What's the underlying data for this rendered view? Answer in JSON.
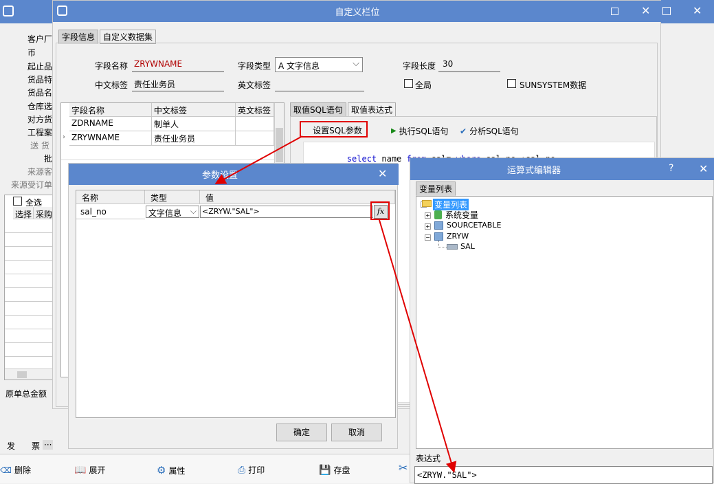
{
  "bg": {
    "left_labels": [
      "客户厂",
      "币",
      "起止品",
      "货品特",
      "货品名",
      "仓库选",
      "对方货",
      "工程案",
      "送  货",
      "批",
      "来源客",
      "来源受订单"
    ],
    "select_all": "全选",
    "grid_headers": [
      "选择",
      "采购"
    ],
    "total_label": "原单总金额",
    "bottom_tabs": [
      "发",
      "票",
      "···"
    ],
    "toolbar": [
      "删除",
      "展开",
      "属性",
      "打印",
      "存盘"
    ]
  },
  "custom_col": {
    "title": "自定义栏位",
    "tabs": [
      "字段信息",
      "自定义数据集"
    ],
    "field_name_label": "字段名称",
    "field_name_value": "ZRYWNAME",
    "field_type_label": "字段类型",
    "field_type_value": "A 文字信息",
    "field_len_label": "字段长度",
    "field_len_value": "30",
    "cn_label": "中文标签",
    "cn_value": "责任业务员",
    "en_label": "英文标签",
    "en_value": "",
    "global_label": "全局",
    "sunsystem_label": "SUNSYSTEM数据",
    "grid_headers": [
      "字段名称",
      "中文标签",
      "英文标签"
    ],
    "grid_rows": [
      [
        "ZDRNAME",
        "制单人",
        ""
      ],
      [
        "ZRYWNAME",
        "责任业务员",
        ""
      ]
    ],
    "sql_tabs": [
      "取值SQL语句",
      "取值表达式"
    ],
    "set_sql_param": "设置SQL参数",
    "exec_sql": "执行SQL语句",
    "analyze_sql": "分析SQL语句",
    "sql_text": [
      "select",
      " name ",
      "from",
      " salm ",
      "where",
      " sal_no=:sal_no"
    ]
  },
  "param_dialog": {
    "title": "参数设置",
    "headers": [
      "名称",
      "类型",
      "值"
    ],
    "row": {
      "name": "sal_no",
      "type": "文字信息",
      "value": "<ZRYW.\"SAL\">"
    },
    "fx_icon": "fx",
    "ok": "确定",
    "cancel": "取消"
  },
  "expr_editor": {
    "title": "运算式编辑器",
    "help": "?",
    "tab": "变量列表",
    "tree": {
      "root": "变量列表",
      "children": [
        "系统变量",
        "SOURCETABLE",
        "ZRYW"
      ],
      "leaf": "SAL"
    },
    "expr_label": "表达式",
    "expr_value": "<ZRYW.\"SAL\">"
  },
  "colors": {
    "titlebar": "#5b87cd",
    "highlight": "#e00000",
    "sql_keyword": "#0000cc",
    "tree_select": "#3399ff"
  }
}
